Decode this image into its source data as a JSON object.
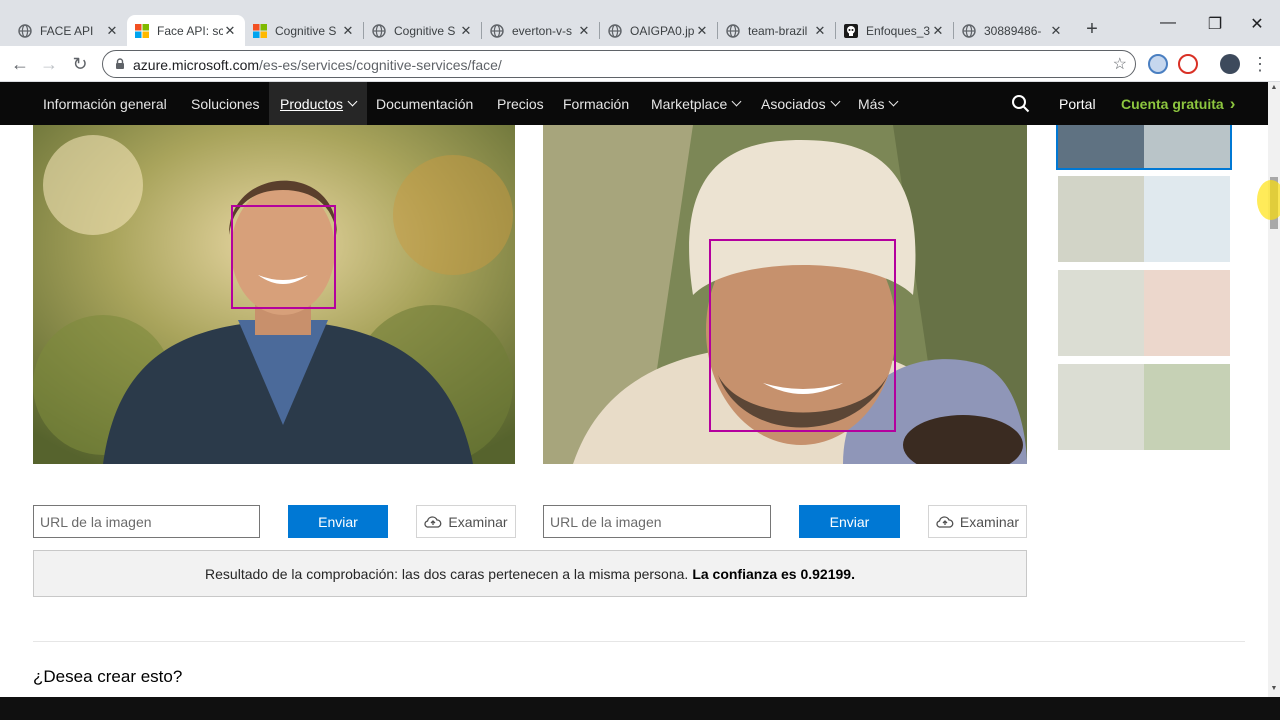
{
  "browser": {
    "tabs": [
      {
        "title": "FACE API",
        "icon": "globe-icon",
        "active": false
      },
      {
        "title": "Face API: sc",
        "icon": "microsoft-logo-icon",
        "active": true
      },
      {
        "title": "Cognitive S",
        "icon": "microsoft-logo-icon",
        "active": false
      },
      {
        "title": "Cognitive S",
        "icon": "globe-icon",
        "active": false
      },
      {
        "title": "everton-v-s",
        "icon": "globe-icon",
        "active": false
      },
      {
        "title": "OAIGPA0.jp",
        "icon": "globe-icon",
        "active": false
      },
      {
        "title": "team-brazil",
        "icon": "globe-icon",
        "active": false
      },
      {
        "title": "Enfoques_3",
        "icon": "skull-icon",
        "active": false
      },
      {
        "title": "30889486-",
        "icon": "globe-icon",
        "active": false
      }
    ],
    "tab_close_glyph": "✕",
    "new_tab_glyph": "+",
    "window_controls": {
      "minimize": "—",
      "maximize": "❐",
      "close": "✕"
    },
    "nav": {
      "back": "←",
      "forward": "→",
      "reload": "↻"
    },
    "address": {
      "host": "azure.microsoft.com",
      "path": "/es-es/services/cognitive-services/face/"
    },
    "bookmark_star": "☆",
    "menu_glyph": "⋮"
  },
  "sitenav": {
    "items": [
      {
        "label": "Información general",
        "dropdown": false,
        "active": false
      },
      {
        "label": "Soluciones",
        "dropdown": false,
        "active": false
      },
      {
        "label": "Productos",
        "dropdown": true,
        "active": true
      },
      {
        "label": "Documentación",
        "dropdown": false,
        "active": false
      },
      {
        "label": "Precios",
        "dropdown": false,
        "active": false
      },
      {
        "label": "Formación",
        "dropdown": false,
        "active": false
      },
      {
        "label": "Marketplace",
        "dropdown": true,
        "active": false
      },
      {
        "label": "Asociados",
        "dropdown": true,
        "active": false
      },
      {
        "label": "Más",
        "dropdown": true,
        "active": false
      }
    ],
    "portal": "Portal",
    "free_account": "Cuenta gratuita",
    "free_account_arrow": "›",
    "accent_color": "#8dc63f"
  },
  "demo": {
    "left": {
      "url_placeholder": "URL de la imagen",
      "send_label": "Enviar",
      "browse_label": "Examinar"
    },
    "right": {
      "url_placeholder": "URL de la imagen",
      "send_label": "Enviar",
      "browse_label": "Examinar"
    },
    "face_box_color": "#b4009e",
    "button_color": "#0078d4",
    "result_prefix": "Resultado de la comprobación: las dos caras pertenecen a la misma persona.",
    "result_bold": "La confianza es 0.92199.",
    "cta_heading": "¿Desea crear esto?"
  }
}
